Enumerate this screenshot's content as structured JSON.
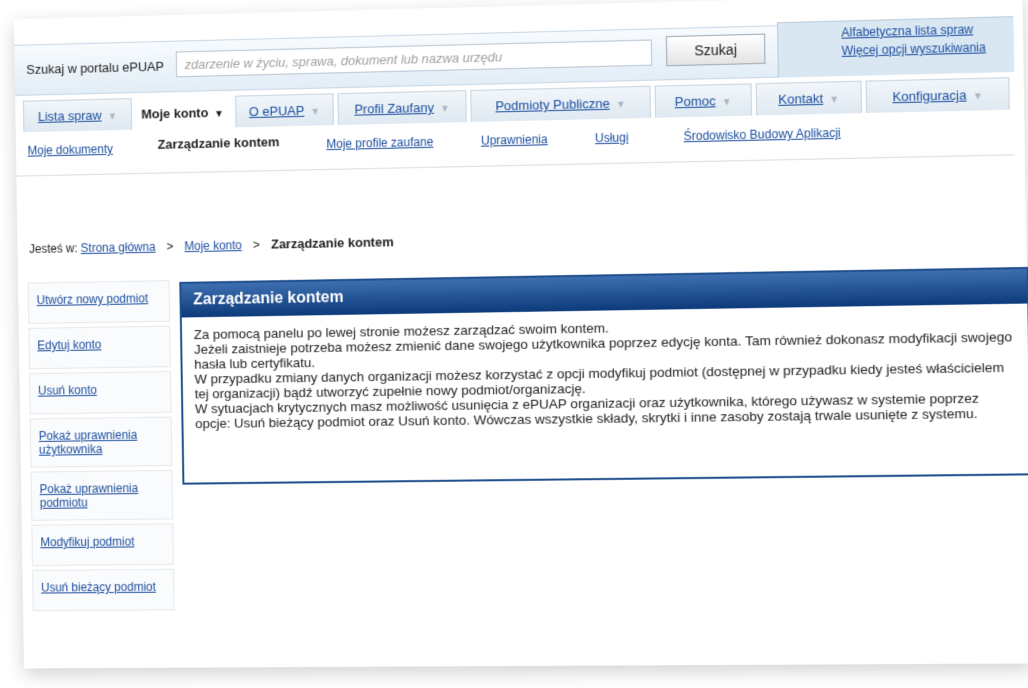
{
  "search": {
    "label": "Szukaj w portalu ePUAP",
    "placeholder": "zdarzenie w życiu, sprawa, dokument lub nazwa urzędu",
    "button_label": "Szukaj"
  },
  "top_links": [
    "Alfabetyczna lista spraw",
    "Więcej opcji wyszukiwania"
  ],
  "menu": [
    {
      "label": "Lista spraw",
      "active": false
    },
    {
      "label": "Moje konto",
      "active": true
    },
    {
      "label": "O ePUAP",
      "active": false
    },
    {
      "label": "Profil Zaufany",
      "active": false
    },
    {
      "label": "Podmioty Publiczne",
      "active": false
    },
    {
      "label": "Pomoc",
      "active": false
    },
    {
      "label": "Kontakt",
      "active": false
    },
    {
      "label": "Konfiguracja",
      "active": false
    }
  ],
  "submenu": [
    {
      "label": "Moje dokumenty",
      "active": false
    },
    {
      "label": "Zarządzanie kontem",
      "active": true
    },
    {
      "label": "Moje profile zaufane",
      "active": false
    },
    {
      "label": "Uprawnienia",
      "active": false
    },
    {
      "label": "Usługi",
      "active": false
    },
    {
      "label": "Środowisko Budowy Aplikacji",
      "active": false
    }
  ],
  "breadcrumb": {
    "prefix": "Jesteś w:",
    "links": [
      "Strona główna",
      "Moje konto"
    ],
    "current": "Zarządzanie kontem",
    "separator": ">"
  },
  "sidebar": [
    "Utwórz nowy podmiot",
    "Edytuj konto",
    "Usuń konto",
    "Pokaż uprawnienia użytkownika",
    "Pokaż uprawnienia podmiotu",
    "Modyfikuj podmiot",
    "Usuń bieżący podmiot"
  ],
  "panel": {
    "title": "Zarządzanie kontem",
    "paragraphs": [
      "Za pomocą panelu po lewej stronie możesz zarządzać swoim kontem.",
      "Jeżeli zaistnieje potrzeba możesz zmienić dane swojego użytkownika poprzez edycję konta. Tam również dokonasz modyfikacji swojego hasła lub certyfikatu.",
      "W przypadku zmiany danych organizacji możesz korzystać z opcji modyfikuj podmiot (dostępnej w przypadku kiedy jesteś właścicielem tej organizacji) bądź utworzyć zupełnie nowy podmiot/organizację.",
      "W sytuacjach krytycznych masz możliwość usunięcia z ePUAP organizacji oraz użytkownika, którego używasz w systemie poprzez opcje: Usuń bieżący podmiot oraz Usuń konto. Wówczas wszystkie składy, skrytki i inne zasoby zostają trwale usunięte z systemu."
    ]
  },
  "colors": {
    "link": "#1a4d9e",
    "panel_header": "#0c3a7a",
    "topbar": "#e2edf6"
  }
}
